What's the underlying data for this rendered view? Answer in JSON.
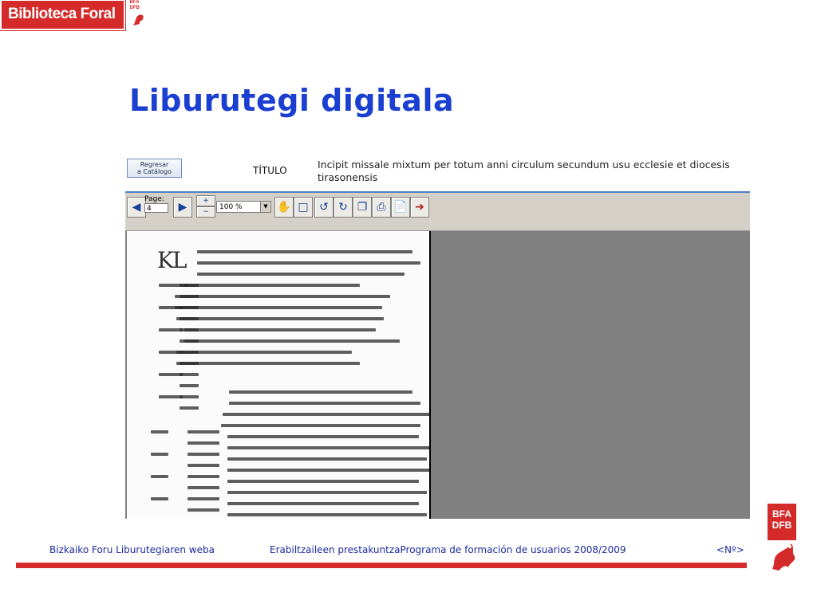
{
  "brand": {
    "name": "Biblioteca Foral",
    "mark_text": "BFA DFB"
  },
  "slide": {
    "title": "Liburutegi digitala"
  },
  "viewer": {
    "return_button": "Regresar\na Catálogo",
    "title_label": "TÍTULO",
    "title_value": "Incipit missale mixtum per totum anni circulum secundum usu ecclesie et diocesis tirasonensis",
    "page_label": "Page:",
    "page_value": "4",
    "zoom_value": "100 %",
    "icons": [
      "prev-page-icon",
      "next-page-icon",
      "zoom-in-icon",
      "zoom-out-icon",
      "hand-tool-icon",
      "select-tool-icon",
      "rotate-left-icon",
      "rotate-right-icon",
      "copy-icon",
      "print-icon",
      "page-icon",
      "exit-icon"
    ]
  },
  "footer": {
    "left": "Bizkaiko Foru Liburutegiaren weba",
    "center": "Erabiltzaileen prestakuntzaPrograma de formación de usuarios 2008/2009",
    "right": "<Nº>",
    "logo_text_top": "BFA",
    "logo_text_bottom": "DFB"
  },
  "colors": {
    "accent_red": "#d42a2a",
    "title_blue": "#1a3fd1",
    "footer_blue": "#1a2ba0"
  }
}
